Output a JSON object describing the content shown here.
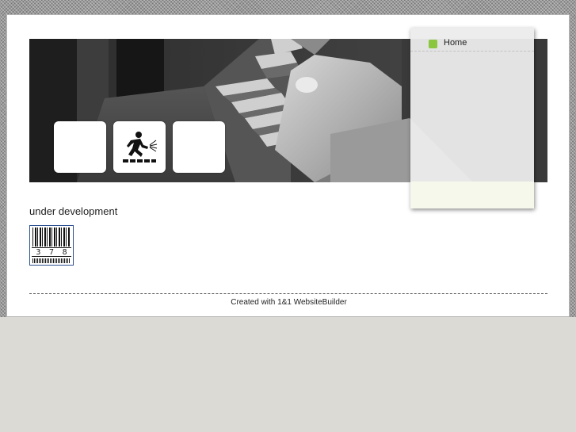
{
  "nav": {
    "items": [
      {
        "label": "Home",
        "bullet_color": "#8cc63f"
      }
    ]
  },
  "content": {
    "status_text": "under development",
    "counter_digits": [
      "3",
      "7",
      "8"
    ]
  },
  "footer": {
    "text": "Created with 1&1 WebsiteBuilder"
  },
  "banner": {
    "icons": [
      "blank-tile",
      "under-construction-icon",
      "blank-tile"
    ]
  },
  "colors": {
    "page_bg": "#dcdad4",
    "accent": "#8cc63f",
    "counter_border": "#2c4f8f"
  }
}
